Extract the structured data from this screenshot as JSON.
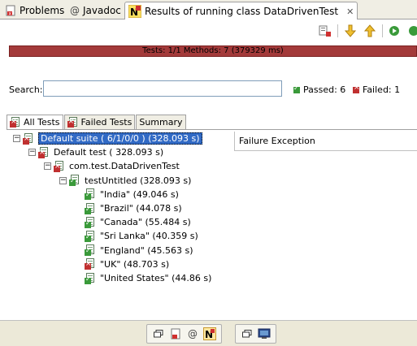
{
  "tabs": [
    {
      "label": "Problems",
      "icon": "problems-icon"
    },
    {
      "label": "Javadoc",
      "icon": "at-icon"
    },
    {
      "label": "Results of running class DataDrivenTest",
      "icon": "testng-icon",
      "close": "✕"
    }
  ],
  "progress": {
    "text": "Tests: 1/1  Methods: 7 (379329 ms)",
    "color": "#a33a3a"
  },
  "search": {
    "label": "Search:",
    "value": "",
    "placeholder": ""
  },
  "summary": {
    "passed": "Passed: 6",
    "failed": "Failed: 1"
  },
  "subtabs": [
    "All Tests",
    "Failed Tests",
    "Summary"
  ],
  "tree": [
    {
      "label": "Default suite ( 6/1/0/0 ) (328.093 s)",
      "status": "fail",
      "level": 0,
      "expanded": true,
      "selected": true
    },
    {
      "label": "Default test ( 328.093 s)",
      "status": "fail",
      "level": 1,
      "expanded": true
    },
    {
      "label": "com.test.DataDrivenTest",
      "status": "fail",
      "level": 2,
      "expanded": true
    },
    {
      "label": "testUntitled  (328.093 s)",
      "status": "pass",
      "level": 3,
      "expanded": true
    },
    {
      "label": "\"India\"  (49.046 s)",
      "status": "pass",
      "level": 4
    },
    {
      "label": "\"Brazil\"  (44.078 s)",
      "status": "pass",
      "level": 4
    },
    {
      "label": "\"Canada\"  (55.484 s)",
      "status": "pass",
      "level": 4
    },
    {
      "label": "\"Sri Lanka\"  (40.359 s)",
      "status": "pass",
      "level": 4
    },
    {
      "label": "\"England\"  (45.563 s)",
      "status": "pass",
      "level": 4
    },
    {
      "label": "\"UK\"  (48.703 s)",
      "status": "fail",
      "level": 4
    },
    {
      "label": "\"United States\"  (44.86 s)",
      "status": "pass",
      "level": 4
    }
  ],
  "failure": {
    "title": "Failure Exception"
  },
  "colors": {
    "pass": "#3a9a3a",
    "fail": "#c03030",
    "selection": "#316ac5"
  }
}
